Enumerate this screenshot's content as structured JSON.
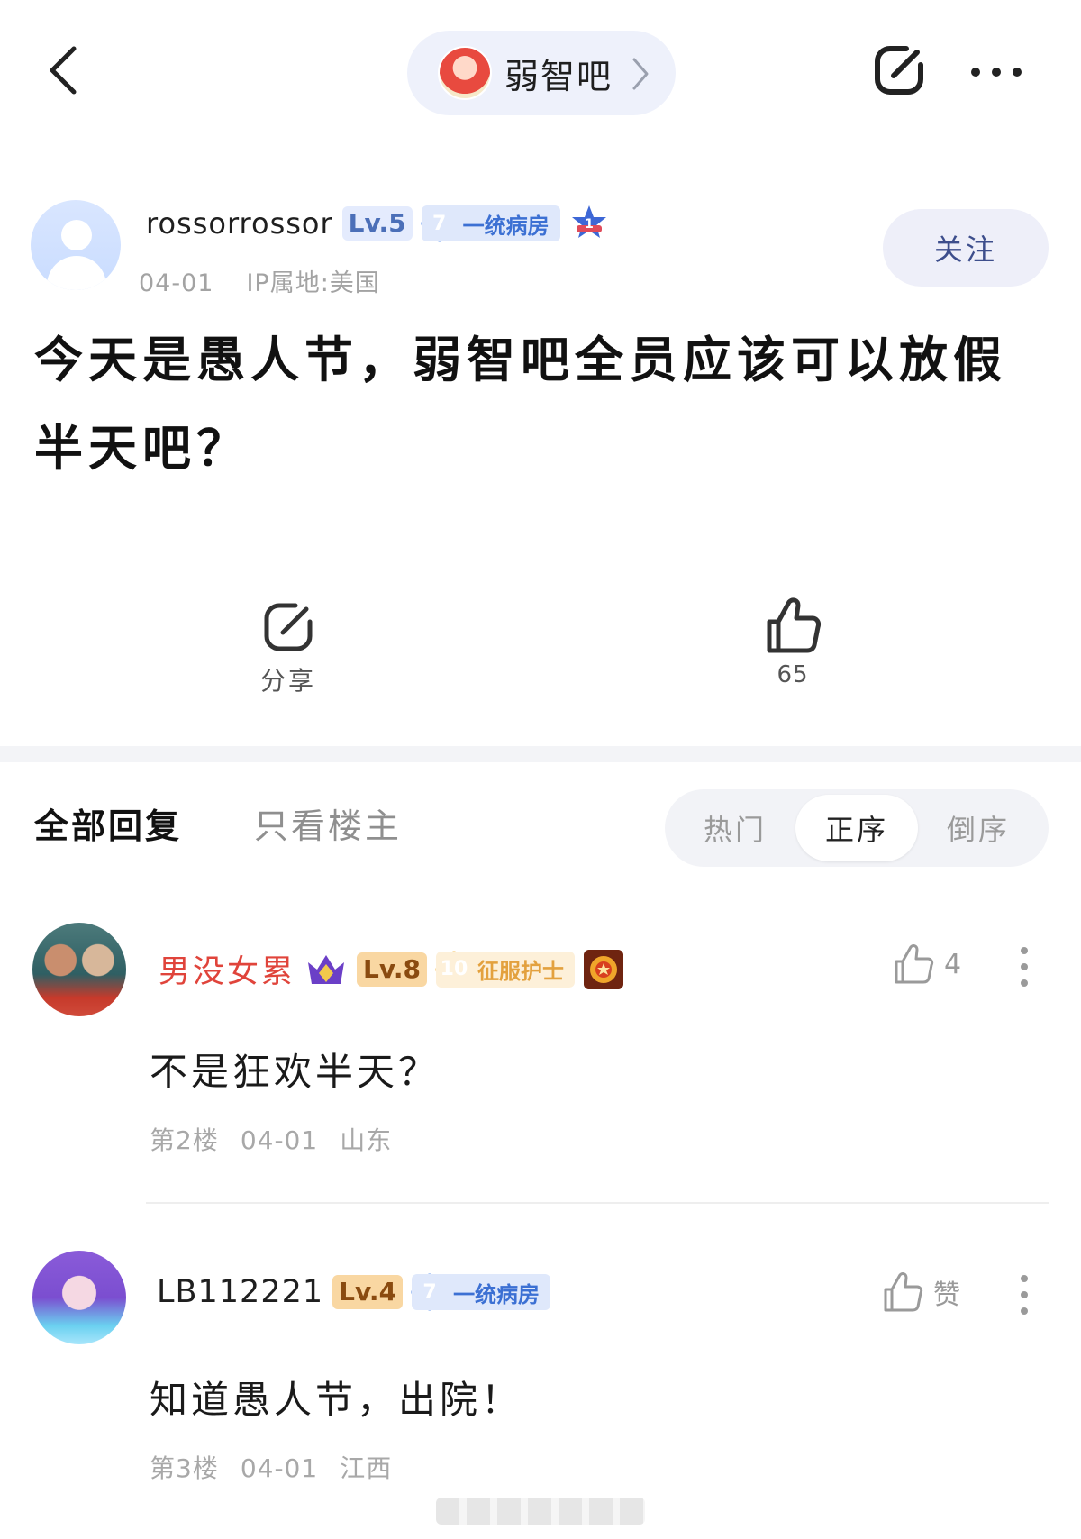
{
  "header": {
    "forum_name": "弱智吧",
    "icons": [
      "back-icon",
      "forum-avatar",
      "chevron-right-icon",
      "share-icon",
      "more-icon"
    ]
  },
  "post": {
    "author": {
      "name": "rossorrossor",
      "level": "Lv.5",
      "rank_number": "7",
      "rank_title": "一统病房",
      "badge_number": "1"
    },
    "date": "04-01",
    "ip": "IP属地:美国",
    "follow_label": "关注",
    "title": "今天是愚人节，弱智吧全员应该可以放假半天吧？",
    "share_label": "分享",
    "like_count": "65"
  },
  "replies_header": {
    "tab_all": "全部回复",
    "tab_op": "只看楼主",
    "sort_options": [
      "热门",
      "正序",
      "倒序"
    ],
    "sort_selected": "正序"
  },
  "replies": [
    {
      "name": "男没女累",
      "level": "Lv.8",
      "rank_number": "10",
      "rank_title": "征服护士",
      "likes": "4",
      "text": "不是狂欢半天？",
      "floor": "第2楼",
      "date": "04-01",
      "location": "山东"
    },
    {
      "name": "LB112221",
      "level": "Lv.4",
      "rank_number": "7",
      "rank_title": "一统病房",
      "likes": "赞",
      "text": "知道愚人节，出院！",
      "floor": "第3楼",
      "date": "04-01",
      "location": "江西"
    }
  ],
  "colors": {
    "accent_blue": "#4d86e8",
    "username_red": "#e0443b",
    "follow_text": "#3d4e8c",
    "pill_bg": "#eef1fb"
  }
}
